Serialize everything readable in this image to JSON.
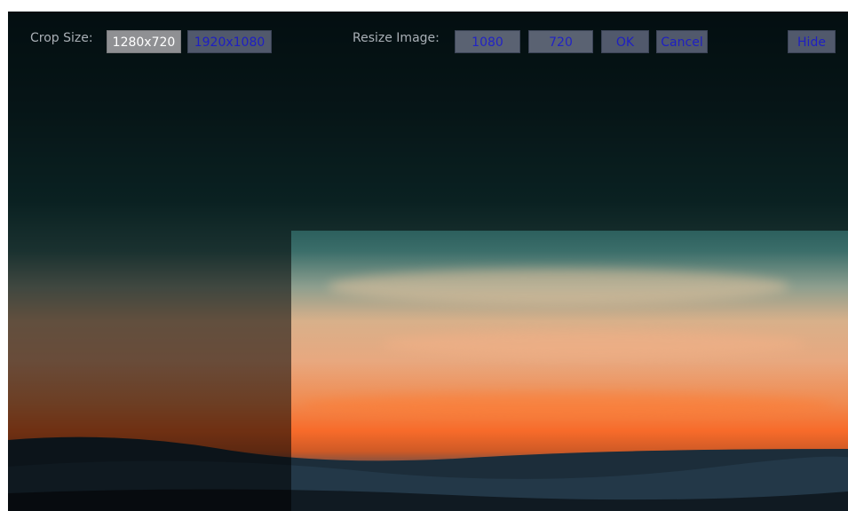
{
  "toolbar": {
    "crop_size_label": "Crop Size:",
    "crop_options": [
      "1280x720",
      "1920x1080"
    ],
    "crop_selected": "1280x720",
    "resize_label": "Resize Image:",
    "resize_width": "1080",
    "resize_height": "720",
    "ok_label": "OK",
    "cancel_label": "Cancel",
    "hide_label": "Hide"
  },
  "colors": {
    "button_bg": "#51596c",
    "button_text": "#1e1fc2",
    "selected_bg": "#8f9093",
    "selected_text": "#ffffff",
    "label_text": "#a9b0b6"
  }
}
